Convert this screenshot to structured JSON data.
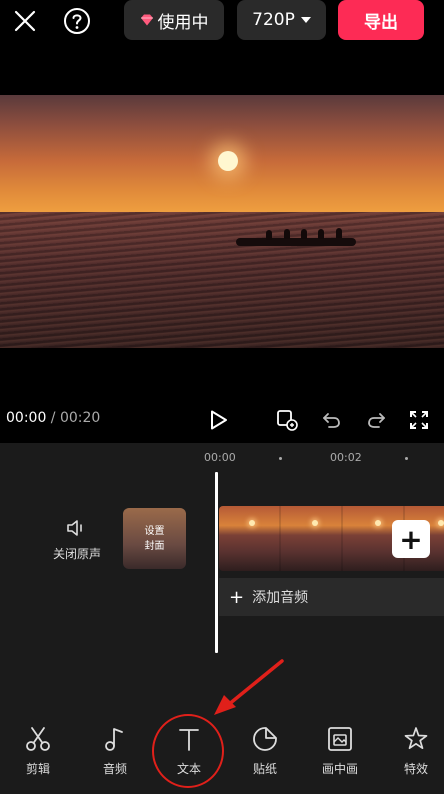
{
  "topbar": {
    "vip_label": "使用中",
    "resolution_label": "720P",
    "export_label": "导出"
  },
  "player": {
    "current_time": "00:00",
    "separator": " / ",
    "duration": "00:20"
  },
  "timeline": {
    "ruler": [
      "00:00",
      "00:02"
    ],
    "mute_label": "关闭原声",
    "cover_line1": "设置",
    "cover_line2": "封面",
    "add_audio_label": "添加音频"
  },
  "toolbar": {
    "items": [
      {
        "label": "剪辑",
        "icon": "scissors-icon"
      },
      {
        "label": "音频",
        "icon": "music-note-icon"
      },
      {
        "label": "文本",
        "icon": "text-icon"
      },
      {
        "label": "贴纸",
        "icon": "sticker-icon"
      },
      {
        "label": "画中画",
        "icon": "picture-in-picture-icon"
      },
      {
        "label": "特效",
        "icon": "effects-star-icon"
      }
    ]
  },
  "colors": {
    "accent": "#fd2b55",
    "annotation": "#e0201a",
    "panel": "#1b1b1b"
  }
}
